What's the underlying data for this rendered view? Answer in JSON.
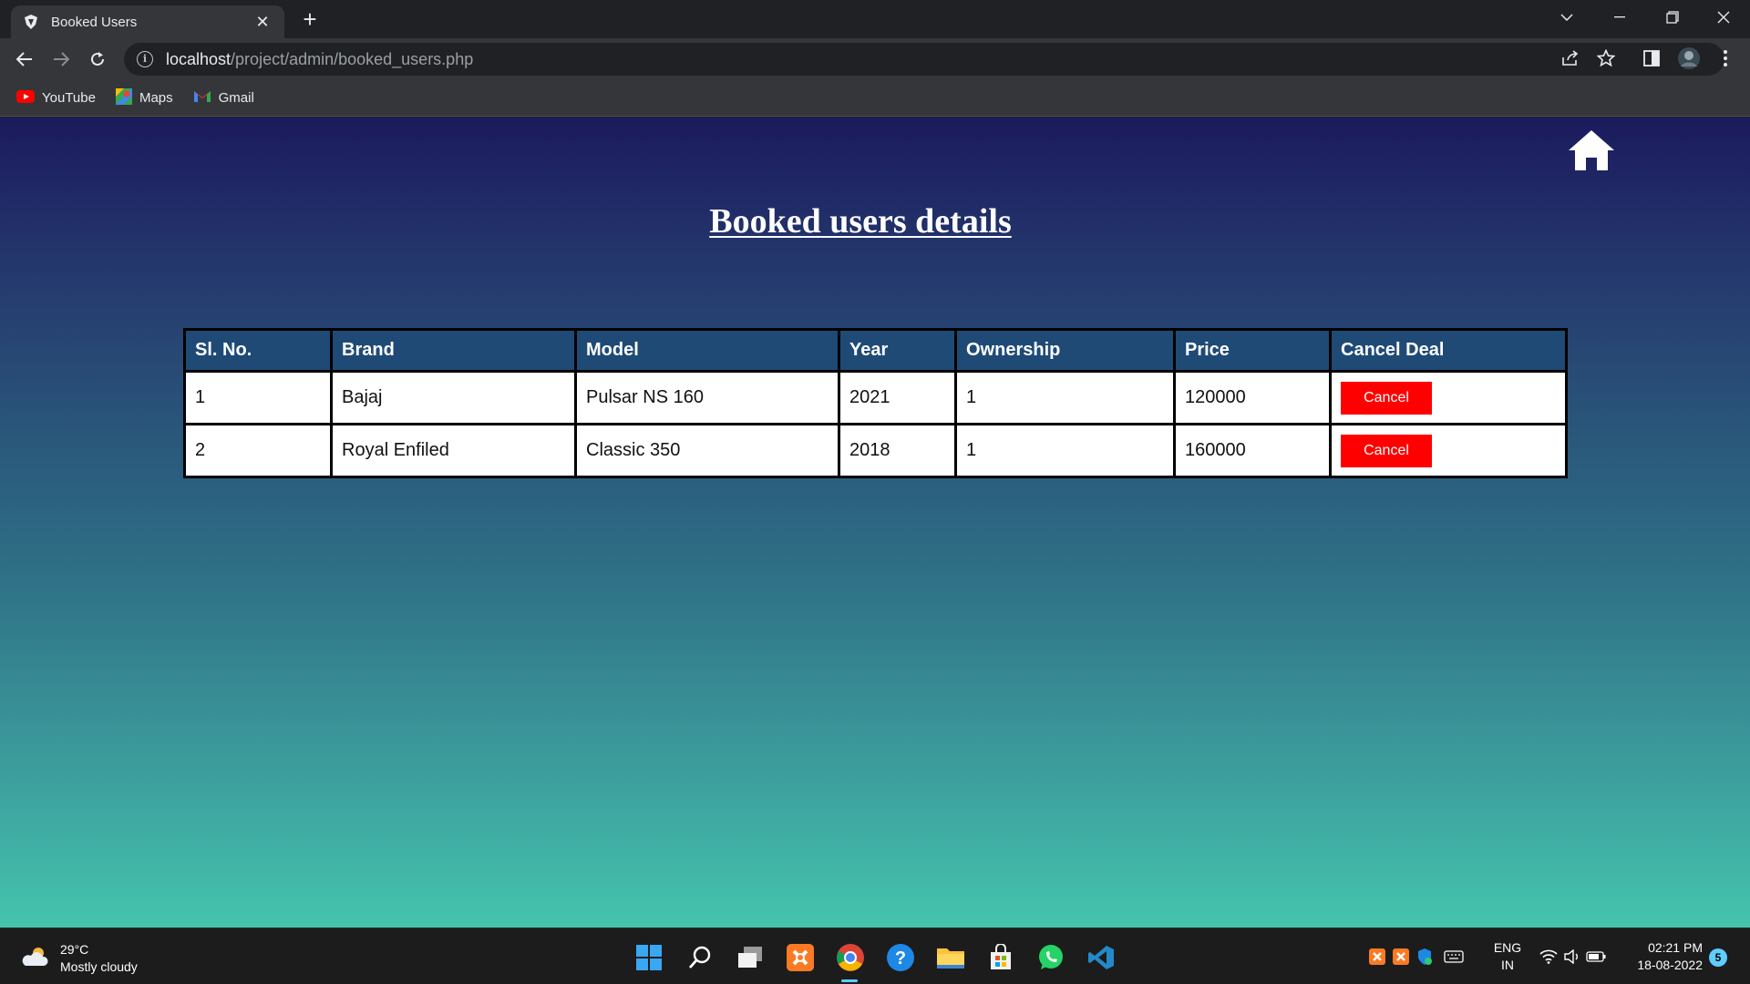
{
  "browser": {
    "tab_title": "Booked Users",
    "url_host": "localhost",
    "url_path": "/project/admin/booked_users.php",
    "bookmarks": [
      "YouTube",
      "Maps",
      "Gmail"
    ]
  },
  "page": {
    "title": "Booked users details",
    "table": {
      "headers": [
        "Sl. No.",
        "Brand",
        "Model",
        "Year",
        "Ownership",
        "Price",
        "Cancel Deal"
      ],
      "rows": [
        {
          "sl": "1",
          "brand": "Bajaj",
          "model": "Pulsar NS 160",
          "year": "2021",
          "ownership": "1",
          "price": "120000",
          "action": "Cancel"
        },
        {
          "sl": "2",
          "brand": "Royal Enfiled",
          "model": "Classic 350",
          "year": "2018",
          "ownership": "1",
          "price": "160000",
          "action": "Cancel"
        }
      ]
    }
  },
  "taskbar": {
    "weather_temp": "29°C",
    "weather_desc": "Mostly cloudy",
    "lang_line1": "ENG",
    "lang_line2": "IN",
    "time": "02:21 PM",
    "date": "18-08-2022",
    "notifications": "5"
  },
  "colors": {
    "cancel_button": "#ff0000",
    "table_header": "#1f4a76",
    "gradient_top": "#1b1a5e",
    "gradient_bottom": "#44c4ad"
  }
}
